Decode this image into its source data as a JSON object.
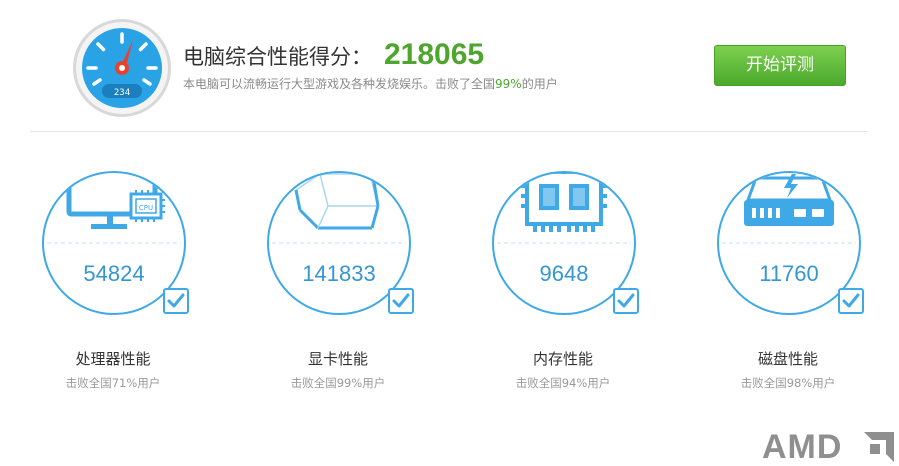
{
  "header": {
    "score_label": "电脑综合性能得分：",
    "score_value": "218065",
    "description_prefix": "本电脑可以流畅运行大型游戏及各种发烧娱乐。击败了全国",
    "description_percent": "99%",
    "description_suffix": "的用户",
    "start_button_label": "开始评测",
    "gauge_readout": "234"
  },
  "metrics": [
    {
      "name": "处理器性能",
      "value": "54824",
      "beat": "击败全国71%用户",
      "icon": "monitor-cpu-icon",
      "chip_label": "CPU"
    },
    {
      "name": "显卡性能",
      "value": "141833",
      "beat": "击败全国99%用户",
      "icon": "graphics-cube-icon"
    },
    {
      "name": "内存性能",
      "value": "9648",
      "beat": "击败全国94%用户",
      "icon": "memory-chip-icon"
    },
    {
      "name": "磁盘性能",
      "value": "11760",
      "beat": "击败全国98%用户",
      "icon": "disk-drive-icon"
    }
  ],
  "brand": {
    "logo_text": "AMD"
  },
  "colors": {
    "accent_blue": "#3fa9e8",
    "score_green": "#4ea62f",
    "button_green": "#5cb836",
    "gauge_needle": "#e8412c"
  }
}
